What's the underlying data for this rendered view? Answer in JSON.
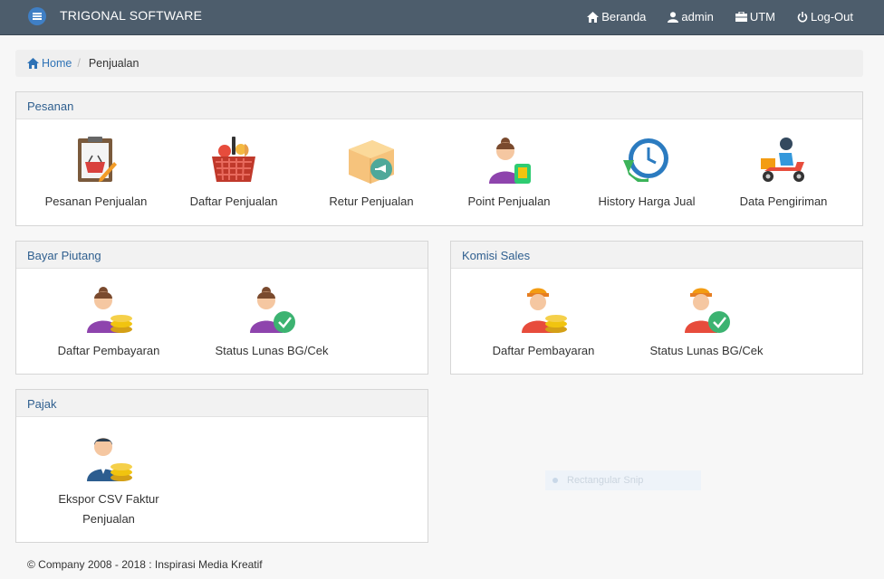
{
  "header": {
    "brand": "TRIGONAL SOFTWARE",
    "nav": [
      {
        "label": "Beranda",
        "icon": "home-icon"
      },
      {
        "label": "admin",
        "icon": "user-icon"
      },
      {
        "label": "UTM",
        "icon": "briefcase-icon"
      },
      {
        "label": "Log-Out",
        "icon": "power-icon"
      }
    ]
  },
  "breadcrumb": {
    "home": "Home",
    "current": "Penjualan"
  },
  "panels": {
    "pesanan": {
      "title": "Pesanan",
      "items": [
        {
          "label": "Pesanan Penjualan",
          "icon": "clipboard-basket-icon"
        },
        {
          "label": "Daftar Penjualan",
          "icon": "shopping-basket-icon"
        },
        {
          "label": "Retur Penjualan",
          "icon": "return-box-icon"
        },
        {
          "label": "Point Penjualan",
          "icon": "woman-points-icon"
        },
        {
          "label": "History Harga Jual",
          "icon": "history-clock-icon"
        },
        {
          "label": "Data Pengiriman",
          "icon": "delivery-scooter-icon"
        }
      ]
    },
    "bayar_piutang": {
      "title": "Bayar Piutang",
      "items": [
        {
          "label": "Daftar Pembayaran",
          "icon": "woman-coins-icon"
        },
        {
          "label": "Status Lunas BG/Cek",
          "icon": "woman-check-icon"
        }
      ]
    },
    "komisi_sales": {
      "title": "Komisi Sales",
      "items": [
        {
          "label": "Daftar Pembayaran",
          "icon": "sales-coins-icon"
        },
        {
          "label": "Status Lunas BG/Cek",
          "icon": "sales-check-icon"
        }
      ]
    },
    "pajak": {
      "title": "Pajak",
      "items": [
        {
          "label_line1": "Ekspor CSV Faktur",
          "label_line2": "Penjualan",
          "icon": "man-coins-icon"
        }
      ]
    }
  },
  "footer": "© Company 2008 - 2018 : Inspirasi Media Kreatif",
  "overlay": "Rectangular Snip",
  "colors": {
    "topbar": "#4d5d6c",
    "accent": "#2f73b6",
    "panel_title": "#2f5f8f"
  }
}
